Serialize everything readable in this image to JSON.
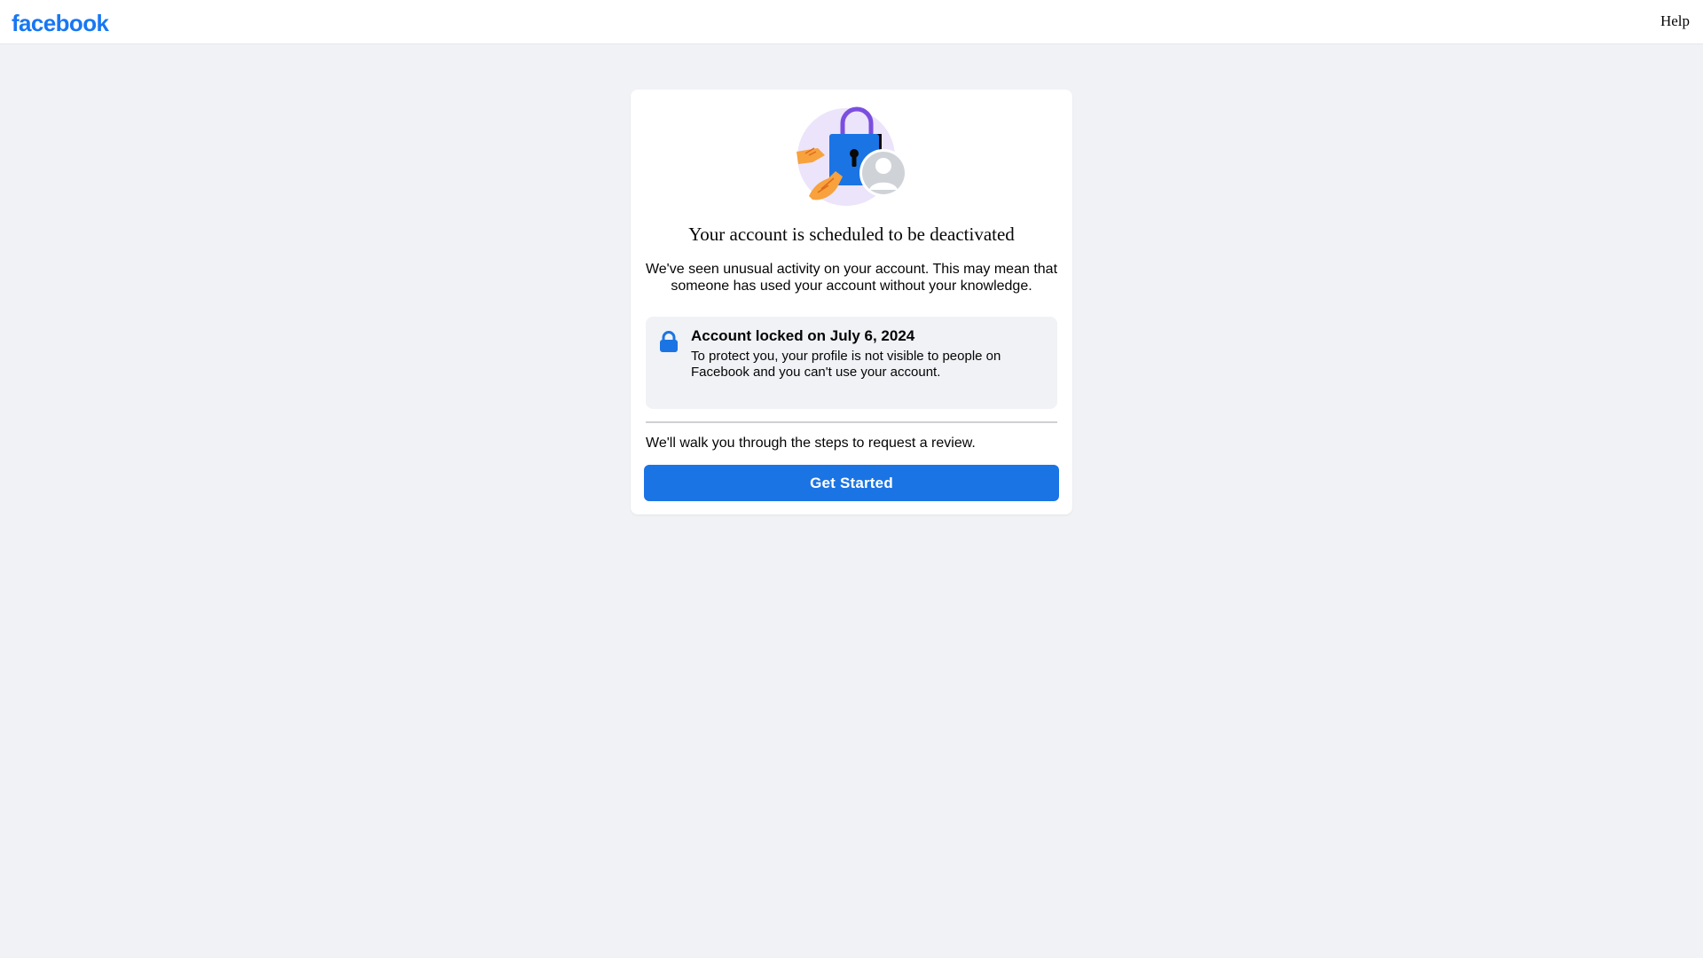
{
  "header": {
    "logo_text": "facebook",
    "help_label": "Help"
  },
  "card": {
    "illustration": "padlock-with-hands-and-profile-illustration",
    "title": "Your account is scheduled to be deactivated",
    "description": "We've seen unusual activity on your account. This may mean that someone has used your account without your knowledge.",
    "notice": {
      "icon": "lock-icon",
      "title": "Account locked on July 6, 2024",
      "body": "To protect you, your profile is not visible to people on Facebook and you can't use your account."
    },
    "walk_text": "We'll walk you through the steps to request a review.",
    "button_label": "Get Started"
  },
  "colors": {
    "brand": "#1877f2",
    "button": "#1b74e4",
    "background": "#f0f2f5",
    "notice_background": "#f0f2f5"
  }
}
